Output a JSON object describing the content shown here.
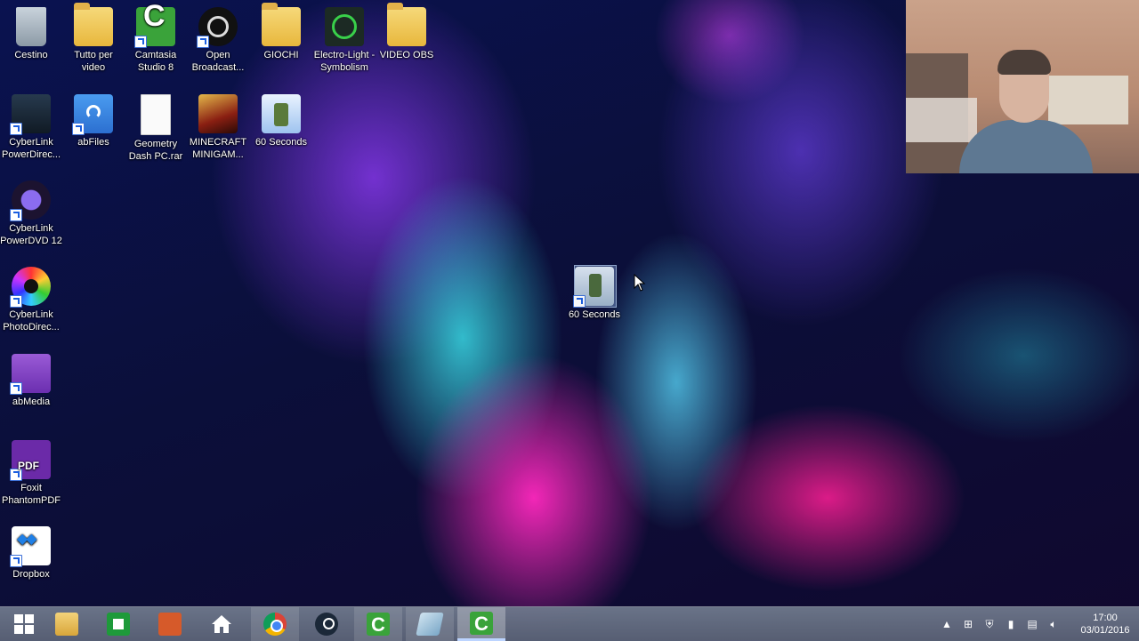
{
  "desktop": {
    "icons": [
      {
        "label": "Cestino",
        "icon": "recycle-bin-icon"
      },
      {
        "label": "Tutto per video",
        "icon": "folder-icon"
      },
      {
        "label": "Camtasia Studio 8",
        "icon": "camtasia-icon"
      },
      {
        "label": "Open Broadcast...",
        "icon": "obs-icon"
      },
      {
        "label": "GIOCHI",
        "icon": "folder-icon"
      },
      {
        "label": "Electro-Light - Symbolism",
        "icon": "media-file-icon"
      },
      {
        "label": "VIDEO OBS",
        "icon": "folder-icon"
      },
      {
        "label": "CyberLink PowerDirec...",
        "icon": "powerdirector-icon"
      },
      {
        "label": "abFiles",
        "icon": "abfiles-icon"
      },
      {
        "label": "Geometry Dash PC.rar",
        "icon": "file-icon"
      },
      {
        "label": "MINECRAFT MINIGAM...",
        "icon": "minecraft-folder-icon"
      },
      {
        "label": "60 Seconds",
        "icon": "game-icon"
      },
      {
        "label": "CyberLink PowerDVD 12",
        "icon": "powerdvd-icon"
      },
      {
        "label": "CyberLink PhotoDirec...",
        "icon": "photodirector-icon"
      },
      {
        "label": "abMedia",
        "icon": "abmedia-icon"
      },
      {
        "label": "Foxit PhantomPDF",
        "icon": "foxit-pdf-icon"
      },
      {
        "label": "Dropbox",
        "icon": "dropbox-icon"
      }
    ],
    "dragged_icon": {
      "label": "60 Seconds",
      "icon": "game-icon"
    }
  },
  "taskbar": {
    "items": [
      {
        "name": "start-button",
        "icon": "windows-logo-icon"
      },
      {
        "name": "file-explorer",
        "icon": "folder-icon"
      },
      {
        "name": "store",
        "icon": "store-icon"
      },
      {
        "name": "office",
        "icon": "office-icon"
      },
      {
        "name": "home",
        "icon": "home-icon"
      },
      {
        "name": "chrome",
        "icon": "chrome-icon"
      },
      {
        "name": "steam",
        "icon": "steam-icon"
      },
      {
        "name": "camtasia-1",
        "icon": "camtasia-icon"
      },
      {
        "name": "notepad",
        "icon": "notepad-icon"
      },
      {
        "name": "camtasia-2",
        "icon": "camtasia-icon"
      }
    ],
    "tray": {
      "time": "17:00",
      "date": "03/01/2016"
    }
  }
}
